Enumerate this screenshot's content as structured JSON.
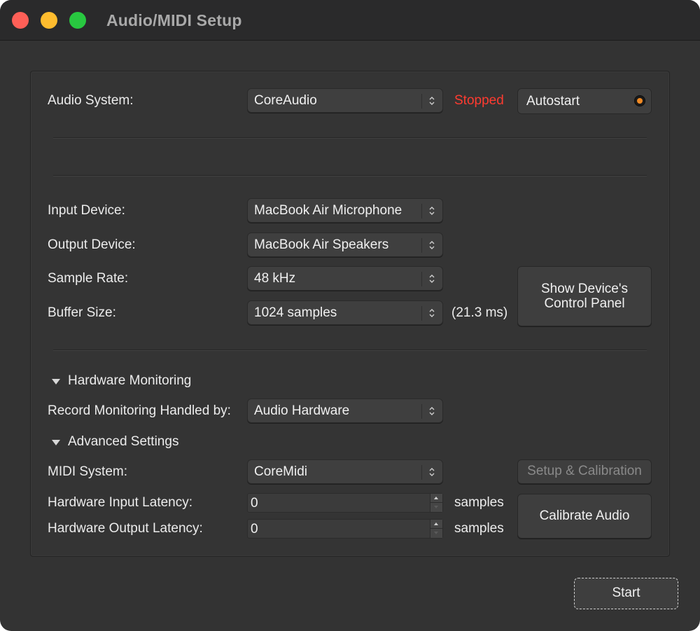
{
  "window": {
    "title": "Audio/MIDI Setup"
  },
  "audio_system": {
    "label": "Audio System:",
    "value": "CoreAudio",
    "status": "Stopped",
    "status_color": "#ff3b30",
    "autostart_label": "Autostart"
  },
  "devices": {
    "input_label": "Input Device:",
    "input_value": "MacBook Air Microphone",
    "output_label": "Output Device:",
    "output_value": "MacBook Air Speakers",
    "sample_rate_label": "Sample Rate:",
    "sample_rate_value": "48 kHz",
    "buffer_label": "Buffer Size:",
    "buffer_value": "1024 samples",
    "buffer_ms": "(21.3 ms)",
    "control_panel_line1": "Show Device's",
    "control_panel_line2": "Control Panel"
  },
  "hardware_monitoring": {
    "section_label": "Hardware Monitoring",
    "record_label": "Record Monitoring Handled by:",
    "record_value": "Audio Hardware"
  },
  "advanced": {
    "section_label": "Advanced Settings",
    "midi_label": "MIDI System:",
    "midi_value": "CoreMidi",
    "setup_calibration_label": "Setup & Calibration",
    "input_latency_label": "Hardware Input Latency:",
    "input_latency_value": "0",
    "output_latency_label": "Hardware Output Latency:",
    "output_latency_value": "0",
    "samples_unit": "samples",
    "calibrate_label": "Calibrate Audio"
  },
  "footer": {
    "start_label": "Start"
  },
  "colors": {
    "accent_led": "#f08a24",
    "background": "#333333"
  }
}
